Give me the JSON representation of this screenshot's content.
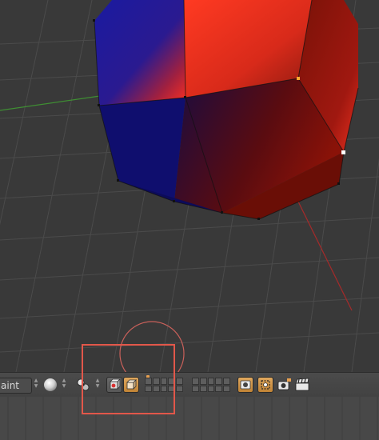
{
  "viewport": {
    "object_colors": {
      "red": "#e8301f",
      "blue": "#10107a",
      "dark_red": "#7a1208"
    },
    "grid_color": "#4a4a4a",
    "axis_x_color": "#b03030",
    "axis_y_color": "#4a9a3a",
    "cursor_circle_color": "#c8605a"
  },
  "header": {
    "mode_label": "aint",
    "viewport_shading_icon": "sphere-shading-icon",
    "pivot_icon": "pivot-point-icon",
    "manipulator_icon": "manipulator-icon",
    "object_mode_icon": "cube-icon",
    "render_icon": "render-icon",
    "camera_icon": "camera-icon",
    "clapboard_icon": "clapboard-icon",
    "accent": "#d99a4e"
  },
  "highlight_color": "#e2574a"
}
